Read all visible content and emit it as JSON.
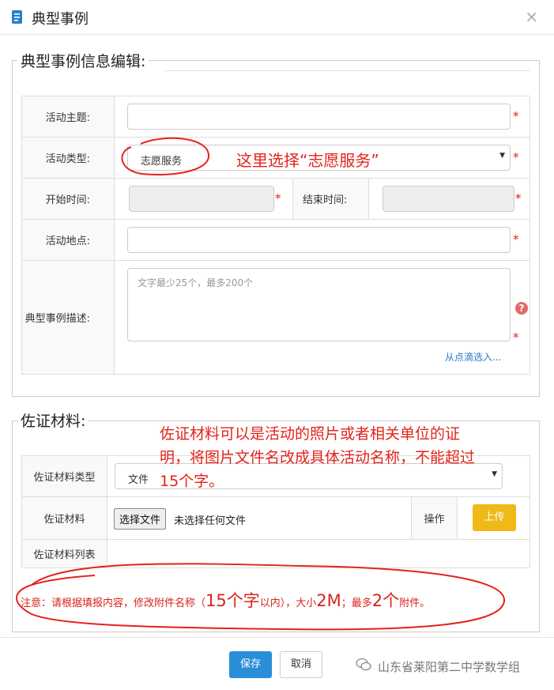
{
  "dialog": {
    "title": "典型事例",
    "close": "×"
  },
  "section1": {
    "legend": "典型事例信息编辑:",
    "fields": {
      "theme_label": "活动主题:",
      "type_label": "活动类型:",
      "type_value": "志愿服务",
      "start_label": "开始时间:",
      "end_label": "结束时间:",
      "location_label": "活动地点:",
      "desc_label": "典型事例描述:",
      "desc_placeholder": "文字最少25个，最多200个",
      "pick_link": "从点滴选入..."
    },
    "required_mark": "*",
    "help_mark": "?"
  },
  "section2": {
    "legend": "佐证材料:",
    "type_label": "佐证材料类型",
    "type_value": "文件",
    "material_label": "佐证材料",
    "choose_file": "选择文件",
    "no_file": "未选择任何文件",
    "op_label": "操作",
    "upload_button": "上传",
    "list_label": "佐证材料列表"
  },
  "notice": {
    "part1": "注意：请根据填报内容，修改附件名称（",
    "big1": "15个字",
    "part2": "以内），大小",
    "big2": "2M",
    "part3": "；最多",
    "big3": "2个",
    "part4": "附件。"
  },
  "annotations": {
    "type_hint": "这里选择“志愿服务”",
    "material_hint_line1": "佐证材料可以是活动的照片或者相关单位的证",
    "material_hint_line2": "明，将图片文件名改成具体活动名称，不能超过",
    "material_hint_line3": "15个字。"
  },
  "footer": {
    "save": "保存",
    "cancel": "取消",
    "watermark": "山东省莱阳第二中学数学组"
  },
  "colors": {
    "required": "#d9221b",
    "annotation": "#e3231b",
    "primary": "#2a8ed8",
    "upload": "#f0b91a"
  }
}
